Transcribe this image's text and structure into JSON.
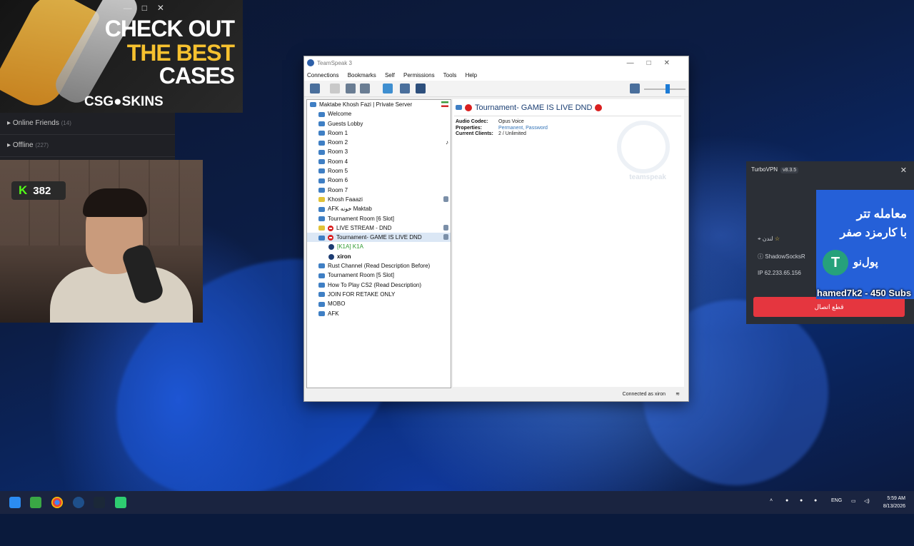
{
  "ad": {
    "line1": "CHECK OUT",
    "line2": "THE BEST",
    "line3": "CASES",
    "brand": "CSG●SKINS"
  },
  "friends": {
    "online_label": "Online Friends",
    "online_count": "(14)",
    "offline_label": "Offline",
    "offline_count": "(227)"
  },
  "kick": {
    "icon": "K",
    "count": "382"
  },
  "teamspeak": {
    "title": "TeamSpeak 3",
    "menu": [
      "Connections",
      "Bookmarks",
      "Self",
      "Permissions",
      "Tools",
      "Help"
    ],
    "server": "Maktabe Khosh Fazi | Private Server",
    "channels": [
      "Welcome",
      "Guests Lobby",
      "Room 1",
      "Room 2",
      "Room 3",
      "Room 4",
      "Room 5",
      "Room 6",
      "Room 7",
      "Khosh Faaazi",
      "AFK خونه Maktab",
      "Tournament Room [6 Slot]",
      "LIVE STREAM - DND",
      "Tournament- GAME IS LIVE DND"
    ],
    "users": [
      "[K1A] K1A",
      "xiron"
    ],
    "channels_after": [
      "Rust Channel (Read Description Before)",
      "Tournament Room [5 Slot]",
      "How To Play CS2 (Read Description)",
      "JOIN FOR RETAKE ONLY",
      "MOBO",
      "AFK"
    ],
    "detail": {
      "title": "Tournament- GAME IS LIVE DND",
      "audio_codec_label": "Audio Codec:",
      "audio_codec": "Opus Voice",
      "properties_label": "Properties:",
      "properties": "Permanent, Password",
      "clients_label": "Current Clients:",
      "clients": "2 / Unlimited",
      "logo_text": "teamspeak"
    },
    "status": "Connected as xiron"
  },
  "vpn": {
    "title": "TurboVPN",
    "version": "v8.3.5",
    "location": "لندن",
    "protocol": "ShadowSocksR",
    "ip_label": "IP",
    "ip": "62.233.65.156",
    "disconnect": "قطع اتصال"
  },
  "vpn_ad": {
    "line1": "معامله تتر",
    "line2": "با کارمزد صفر",
    "coin": "T",
    "brand": "پول‌نو"
  },
  "subs_overlay": "hamed7k2 - 450 Subs",
  "taskbar": {
    "lang": "ENG",
    "time": "5:59 AM",
    "date": "8/13/2026"
  },
  "colors": {
    "accent": "#1c7bd6",
    "dnd": "#d91f1f",
    "vpn_button": "#e5363f",
    "kick": "#53fc18"
  }
}
